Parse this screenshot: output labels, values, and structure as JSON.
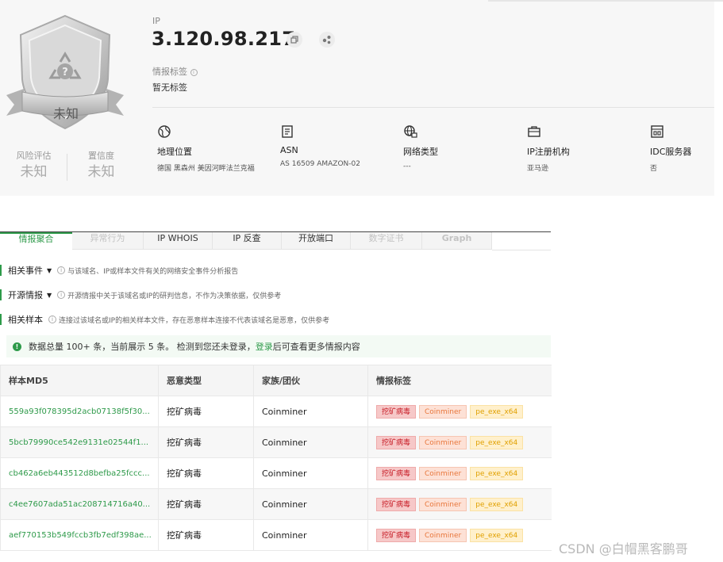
{
  "header": {
    "ip_label": "IP",
    "ip_value": "3.120.98.217",
    "tag_title": "情报标签",
    "tag_value": "暂无标签"
  },
  "badge": {
    "text": "未知"
  },
  "scores": [
    {
      "label": "风险评估",
      "value": "未知"
    },
    {
      "label": "置信度",
      "value": "未知"
    }
  ],
  "info": [
    {
      "icon": "globe-icon",
      "title": "地理位置",
      "value": "德国 黑森州 美因河畔法兰克福"
    },
    {
      "icon": "document-icon",
      "title": "ASN",
      "value": "AS 16509 AMAZON-02"
    },
    {
      "icon": "network-icon",
      "title": "网络类型",
      "value": "---"
    },
    {
      "icon": "briefcase-icon",
      "title": "IP注册机构",
      "value": "亚马逊"
    },
    {
      "icon": "server-icon",
      "title": "IDC服务器",
      "value": "否"
    }
  ],
  "tabs": [
    {
      "label": "情报聚合",
      "state": "active"
    },
    {
      "label": "异常行为",
      "state": "disabled"
    },
    {
      "label": "IP WHOIS",
      "state": "normal"
    },
    {
      "label": "IP 反查",
      "state": "normal"
    },
    {
      "label": "开放端口",
      "state": "normal"
    },
    {
      "label": "数字证书",
      "state": "disabled"
    },
    {
      "label": "Graph",
      "state": "disabled"
    }
  ],
  "sections": [
    {
      "title": "相关事件",
      "hint": "与该域名、IP或样本文件有关的网络安全事件分析报告"
    },
    {
      "title": "开源情报",
      "hint": "开源情报中关于该域名或IP的研判信息，不作为决策依据，仅供参考"
    },
    {
      "title": "相关样本",
      "hint": "连接过该域名或IP的相关样本文件，存在恶意样本连接不代表该域名是恶意，仅供参考"
    }
  ],
  "notice": {
    "text": "数据总量 100+ 条，当前展示 5 条。 检测到您还未登录，",
    "link": "登录",
    "suffix": "后可查看更多情报内容"
  },
  "table": {
    "columns": [
      "样本MD5",
      "恶意类型",
      "家族/团伙",
      "情报标签"
    ],
    "rows": [
      {
        "md5": "559a93f078395d2acb07138f5f30...",
        "type": "挖矿病毒",
        "family": "Coinminer"
      },
      {
        "md5": "5bcb79990ce542e9131e02544f1...",
        "type": "挖矿病毒",
        "family": "Coinminer"
      },
      {
        "md5": "cb462a6eb443512d8befba25fccc...",
        "type": "挖矿病毒",
        "family": "Coinminer"
      },
      {
        "md5": "c4ee7607ada51ac208714716a40...",
        "type": "挖矿病毒",
        "family": "Coinminer"
      },
      {
        "md5": "aef770153b549fccb3fb7edf398ae...",
        "type": "挖矿病毒",
        "family": "Coinminer"
      }
    ],
    "tags": [
      "挖矿病毒",
      "Coinminer",
      "pe_exe_x64"
    ]
  },
  "colors": {
    "accent": "#2e9a4a",
    "tag_red": "#c8202a",
    "tag_orange": "#e8773c",
    "tag_yellow": "#e0a000"
  },
  "watermark": "CSDN @白帽黑客鹏哥"
}
